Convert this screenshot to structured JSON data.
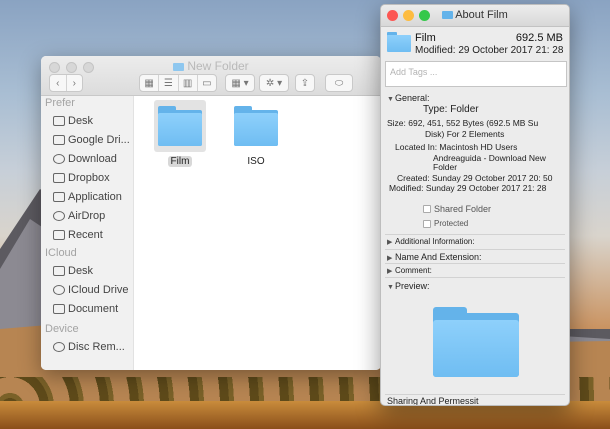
{
  "finder": {
    "title": "New Folder",
    "toolbar": {
      "back": "‹",
      "forward": "›",
      "view_icons": "▦",
      "view_list": "☰",
      "view_columns": "▥",
      "view_gallery": "▭",
      "arrange": "▦ ▾",
      "action": "✲ ▾",
      "share": "⇪",
      "tags": "⬭"
    },
    "sidebar": {
      "favorites_header": "Prefer",
      "favorites": [
        {
          "label": "Desk",
          "icon": "desktop-icon"
        },
        {
          "label": "Google Dri...",
          "icon": "google-drive-icon"
        },
        {
          "label": "Download",
          "icon": "download-icon"
        },
        {
          "label": "Dropbox",
          "icon": "dropbox-icon"
        },
        {
          "label": "Application",
          "icon": "applications-icon"
        },
        {
          "label": "AirDrop",
          "icon": "airdrop-icon"
        },
        {
          "label": "Recent",
          "icon": "recents-icon"
        }
      ],
      "icloud_header": "ICloud",
      "icloud": [
        {
          "label": "Desk",
          "icon": "desktop-icon"
        },
        {
          "label": "ICloud Drive",
          "icon": "icloud-icon"
        },
        {
          "label": "Document",
          "icon": "documents-icon"
        }
      ],
      "devices_header": "Device",
      "devices": [
        {
          "label": "Disc Rem...",
          "icon": "disc-icon"
        }
      ]
    },
    "items": [
      {
        "label": "Film",
        "selected": true
      },
      {
        "label": "ISO",
        "selected": false
      }
    ]
  },
  "info": {
    "title": "About Film",
    "name": "Film",
    "size": "692.5 MB",
    "modified": "Modified: 29 October 2017 21: 28",
    "tags_placeholder": "Add Tags ...",
    "general_header": "General:",
    "kind": "Type: Folder",
    "size_line1": "Size: 692, 451, 552 Bytes (692.5 MB Su",
    "size_line2": "Disk) For 2 Elements",
    "location_line1": "Located In: Macintosh HD Users",
    "location_line2": "Andreaguida - Download New",
    "location_line3": "Folder",
    "created": "Created: Sunday 29 October 2017 20: 50",
    "modified_long": "Modified: Sunday 29 October 2017 21: 28",
    "shared_folder": "Shared Folder",
    "protected": "Protected",
    "additional_info": "Additional Information:",
    "name_extension": "Name And Extension:",
    "comment": "Comment:",
    "preview": "Preview:",
    "sharing": "Sharing And Permessit",
    "colors": {
      "close": "#fc5753",
      "minimize": "#fdbc40",
      "zoom": "#34c84a"
    }
  }
}
